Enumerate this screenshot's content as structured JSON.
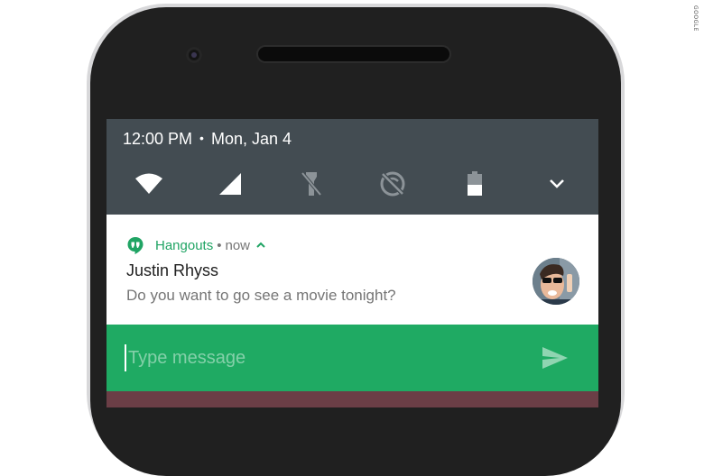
{
  "watermark": "GOOGLE",
  "status_bar": {
    "time": "12:00 PM",
    "separator": "•",
    "date": "Mon, Jan 4"
  },
  "quick_settings": [
    {
      "icon": "wifi-icon",
      "enabled": true
    },
    {
      "icon": "cellular-signal-icon",
      "enabled": true
    },
    {
      "icon": "flashlight-off-icon",
      "enabled": false
    },
    {
      "icon": "auto-rotate-off-icon",
      "enabled": false
    },
    {
      "icon": "battery-icon",
      "level": 0.5
    },
    {
      "icon": "expand-chevron-icon"
    }
  ],
  "notification": {
    "app_name": "Hangouts",
    "separator": "•",
    "time": "now",
    "sender": "Justin Rhyss",
    "message": "Do you want to go see a movie tonight?",
    "avatar": "contact-avatar"
  },
  "reply": {
    "placeholder": "Type message",
    "value": "",
    "send_icon": "send-icon"
  },
  "colors": {
    "shade_background": "#434c52",
    "hangouts_green": "#20a464",
    "reply_green": "#1faa63",
    "phone_body": "#202020"
  }
}
